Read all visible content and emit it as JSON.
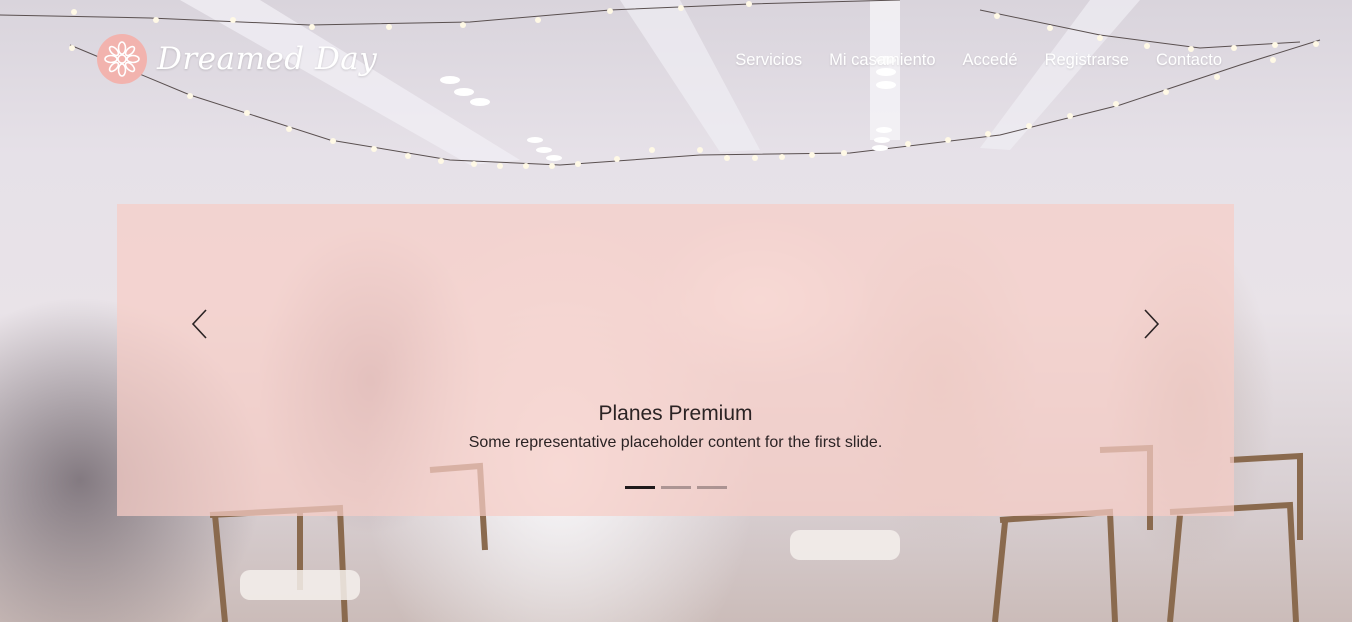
{
  "brand": {
    "name": "Dreamed Day",
    "badge_color": "#f2b3ae"
  },
  "nav": {
    "items": [
      {
        "label": "Servicios"
      },
      {
        "label": "Mi casamiento"
      },
      {
        "label": "Accedé"
      },
      {
        "label": "Registrarse"
      },
      {
        "label": "Contacto"
      }
    ]
  },
  "carousel": {
    "overlay_color": "#f7cdc6",
    "prev_icon": "chevron-left-icon",
    "next_icon": "chevron-right-icon",
    "active_slide": 1,
    "slide_count": 3,
    "slide": {
      "title": "Planes Premium",
      "text": "Some representative placeholder content for the first slide."
    }
  }
}
